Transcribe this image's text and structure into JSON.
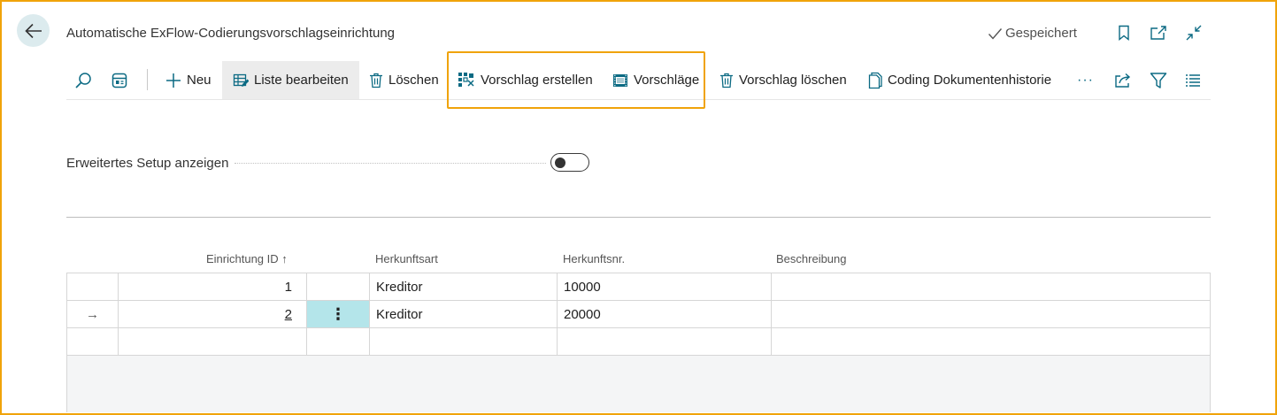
{
  "header": {
    "title": "Automatische ExFlow-Codierungsvorschlagseinrichtung",
    "saved_status": "Gespeichert",
    "icons": [
      "back-arrow-icon",
      "checkmark-icon",
      "bookmark-icon",
      "open-new-window-icon",
      "collapse-icon"
    ]
  },
  "actions": {
    "new": "Neu",
    "edit_list": "Liste bearbeiten",
    "delete": "Löschen",
    "create_suggestion": "Vorschlag erstellen",
    "suggestions": "Vorschläge",
    "delete_suggestion": "Vorschlag löschen",
    "document_history": "Coding Dokumentenhistorie",
    "more": "···",
    "icons": [
      "search-icon",
      "view-layout-icon",
      "plus-icon",
      "edit-list-icon",
      "trash-icon",
      "suggestion-create-icon",
      "suggestions-film-icon",
      "document-icon",
      "share-icon",
      "filter-icon",
      "list-icon"
    ]
  },
  "toggle": {
    "label": "Erweitertes Setup anzeigen",
    "on": false
  },
  "table": {
    "columns": [
      "Einrichtung ID",
      "Herkunftsart",
      "Herkunftsnr.",
      "Beschreibung"
    ],
    "sort_indicator": "↑",
    "rows": [
      {
        "marker": "",
        "id": "1",
        "menu": "",
        "origin_type": "Kreditor",
        "origin_no": "10000",
        "description": ""
      },
      {
        "marker": "→",
        "id": "2",
        "menu": "⋮",
        "origin_type": "Kreditor",
        "origin_no": "20000",
        "description": ""
      },
      {
        "marker": "",
        "id": "",
        "menu": "",
        "origin_type": "",
        "origin_no": "",
        "description": ""
      }
    ]
  },
  "colors": {
    "highlight": "#f0a30a",
    "accent": "#0b6a83",
    "selected_cell": "#b4e5ea"
  }
}
